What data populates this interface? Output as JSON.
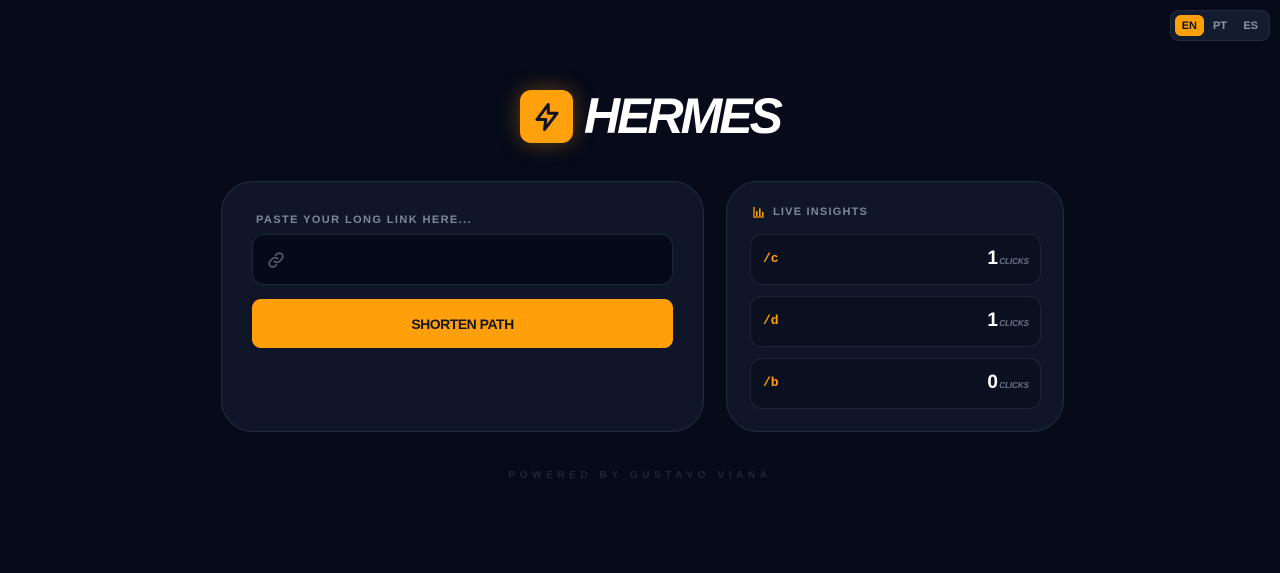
{
  "languages": [
    {
      "code": "EN",
      "active": true
    },
    {
      "code": "PT",
      "active": false
    },
    {
      "code": "ES",
      "active": false
    }
  ],
  "brand": {
    "name": "HERMES",
    "icon": "lightning-bolt-icon",
    "accent": "#ff9f0a"
  },
  "shortener": {
    "label": "PASTE YOUR LONG LINK HERE...",
    "input_value": "",
    "input_icon": "link-icon",
    "button_label": "SHORTEN PATH"
  },
  "insights": {
    "title": "LIVE INSIGHTS",
    "icon": "bar-chart-icon",
    "items": [
      {
        "path": "/c",
        "count": "1",
        "unit": "CLICKS"
      },
      {
        "path": "/d",
        "count": "1",
        "unit": "CLICKS"
      },
      {
        "path": "/b",
        "count": "0",
        "unit": "CLICKS"
      }
    ]
  },
  "footer": {
    "text": "POWERED BY GUSTAVO VIANA"
  }
}
